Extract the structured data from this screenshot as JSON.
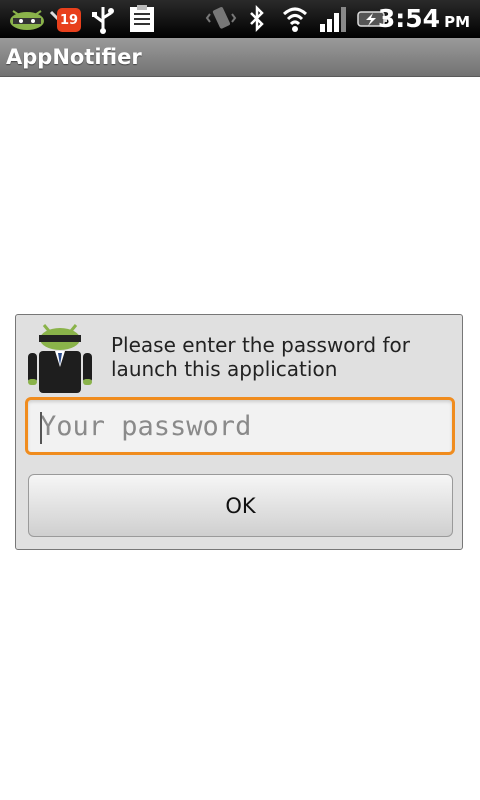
{
  "status_bar": {
    "notification_count": "19",
    "time": "3:54",
    "ampm": "PM",
    "icons": [
      "android-icon",
      "missed-call-icon",
      "usb-icon",
      "clipboard-icon",
      "vibrate-icon",
      "bluetooth-icon",
      "wifi-icon",
      "signal-icon",
      "battery-charging-icon"
    ]
  },
  "app": {
    "title": "AppNotifier"
  },
  "dialog": {
    "message": "Please enter the password for launch this application",
    "password": {
      "value": "",
      "placeholder": "Your password"
    },
    "ok_label": "OK"
  },
  "colors": {
    "focus_border": "#f08c1e",
    "badge": "#e8401c",
    "titlebar": "#8a8a8a",
    "dialog_bg": "#e0e0e0"
  }
}
